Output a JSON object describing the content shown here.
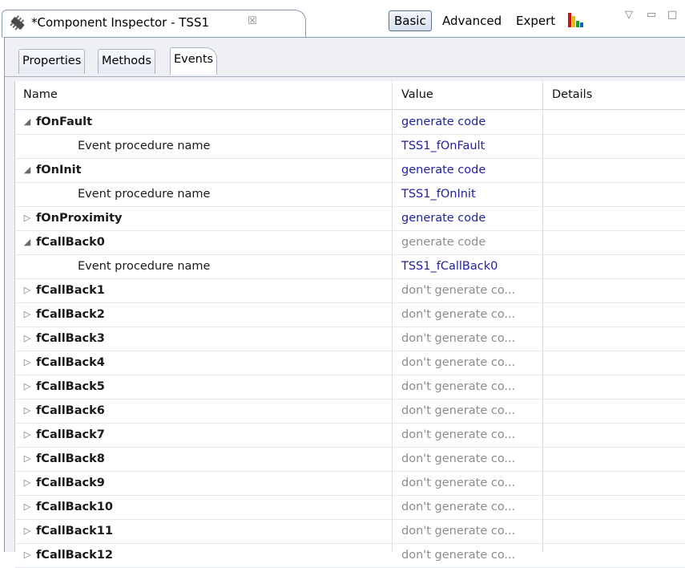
{
  "window": {
    "title": "*Component Inspector - TSS1",
    "close_glyph": "☒",
    "mode_buttons": [
      "Basic",
      "Advanced",
      "Expert"
    ],
    "active_mode": "Basic",
    "icons": [
      "component-icon",
      "close-icon",
      "chart-icon",
      "view-menu-icon",
      "minimize-icon",
      "maximize-icon"
    ],
    "glyphs": {
      "view_menu": "▽",
      "minimize": "▭",
      "maximize": "□"
    }
  },
  "tabs": [
    "Properties",
    "Methods",
    "Events"
  ],
  "active_tab": "Events",
  "table": {
    "headers": {
      "name": "Name",
      "value": "Value",
      "details": "Details"
    },
    "rows": [
      {
        "type": "group",
        "expanded": true,
        "name": "fOnFault",
        "value": "generate code",
        "value_style": "blue"
      },
      {
        "type": "child",
        "name": "Event procedure name",
        "value": "TSS1_fOnFault",
        "value_style": "blue"
      },
      {
        "type": "group",
        "expanded": true,
        "name": "fOnInit",
        "value": "generate code",
        "value_style": "blue"
      },
      {
        "type": "child",
        "name": "Event procedure name",
        "value": "TSS1_fOnInit",
        "value_style": "blue"
      },
      {
        "type": "group",
        "expanded": false,
        "name": "fOnProximity",
        "value": "generate code",
        "value_style": "blue"
      },
      {
        "type": "group",
        "expanded": true,
        "name": "fCallBack0",
        "value": "generate code",
        "value_style": "gray"
      },
      {
        "type": "child",
        "name": "Event procedure name",
        "value": "TSS1_fCallBack0",
        "value_style": "blue"
      },
      {
        "type": "group",
        "expanded": false,
        "name": "fCallBack1",
        "value": "don't generate co...",
        "value_style": "gray"
      },
      {
        "type": "group",
        "expanded": false,
        "name": "fCallBack2",
        "value": "don't generate co...",
        "value_style": "gray"
      },
      {
        "type": "group",
        "expanded": false,
        "name": "fCallBack3",
        "value": "don't generate co...",
        "value_style": "gray"
      },
      {
        "type": "group",
        "expanded": false,
        "name": "fCallBack4",
        "value": "don't generate co...",
        "value_style": "gray"
      },
      {
        "type": "group",
        "expanded": false,
        "name": "fCallBack5",
        "value": "don't generate co...",
        "value_style": "gray"
      },
      {
        "type": "group",
        "expanded": false,
        "name": "fCallBack6",
        "value": "don't generate co...",
        "value_style": "gray"
      },
      {
        "type": "group",
        "expanded": false,
        "name": "fCallBack7",
        "value": "don't generate co...",
        "value_style": "gray"
      },
      {
        "type": "group",
        "expanded": false,
        "name": "fCallBack8",
        "value": "don't generate co...",
        "value_style": "gray"
      },
      {
        "type": "group",
        "expanded": false,
        "name": "fCallBack9",
        "value": "don't generate co...",
        "value_style": "gray"
      },
      {
        "type": "group",
        "expanded": false,
        "name": "fCallBack10",
        "value": "don't generate co...",
        "value_style": "gray"
      },
      {
        "type": "group",
        "expanded": false,
        "name": "fCallBack11",
        "value": "don't generate co...",
        "value_style": "gray"
      },
      {
        "type": "group",
        "expanded": false,
        "name": "fCallBack12",
        "value": "don't generate co...",
        "value_style": "gray"
      }
    ]
  },
  "colors": {
    "value_blue": "#1f1fa0",
    "value_gray": "#8c8c8c",
    "panel_bg": "#eef0f4",
    "border": "#8a9bb4"
  }
}
